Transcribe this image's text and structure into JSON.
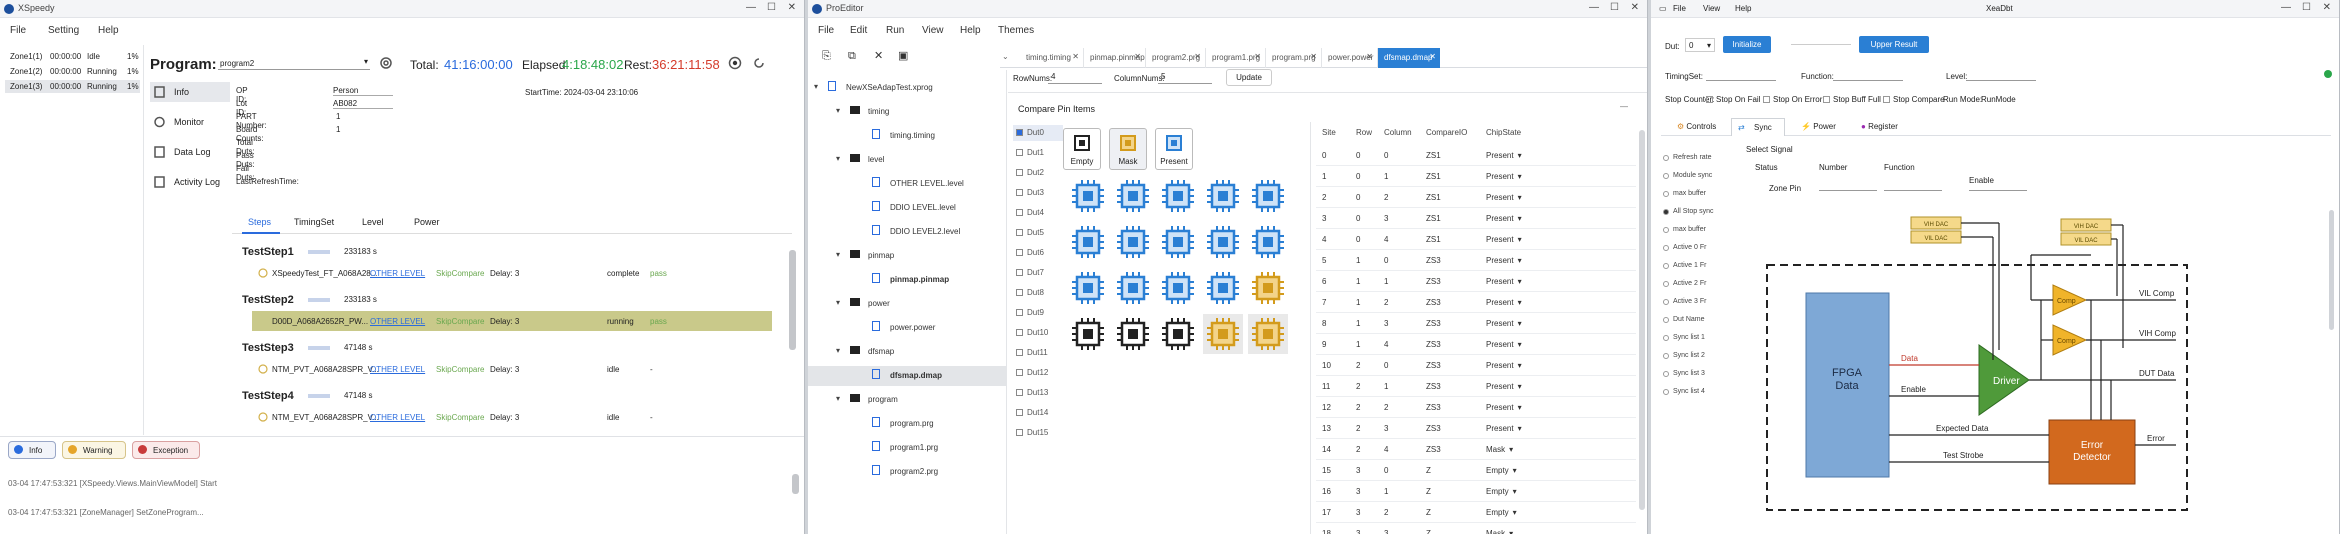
{
  "w1": {
    "title": "XSpeedy",
    "menu": [
      "File",
      "Setting",
      "Help"
    ],
    "zones": [
      {
        "name": "Zone1(1)",
        "time": "00:00:00",
        "state": "Idle",
        "pct": "1%"
      },
      {
        "name": "Zone1(2)",
        "time": "00:00:00",
        "state": "Running",
        "pct": "1%"
      },
      {
        "name": "Zone1(3)",
        "time": "00:00:00",
        "state": "Running",
        "pct": "1%"
      }
    ],
    "program_label": "Program:",
    "program_value": "program2",
    "total_label": "Total:",
    "total_value": "41:16:00:00",
    "elapsed_label": "Elapsed:",
    "elapsed_value": "4:18:48:02",
    "rest_label": "Rest:",
    "rest_value": "36:21:11:58",
    "nav": [
      "Info",
      "Monitor",
      "Data Log",
      "Activity Log"
    ],
    "info_labels": [
      "OP ID:",
      "Lot ID:",
      "PART Number:",
      "Board Counts:",
      "Total Duts:",
      "Pass Duts:",
      "Fail Duts:",
      "LastRefreshTime:"
    ],
    "info_values": [
      "Person",
      "AB082",
      "1",
      "1",
      "",
      "",
      "",
      ""
    ],
    "start_time": "StartTime: 2024-03-04 23:10:06",
    "subtabs": [
      "Steps",
      "TimingSet",
      "Level",
      "Power"
    ],
    "steps": [
      {
        "name": "TestStep1",
        "id": "233183 s",
        "detail": "XSpeedyTest_FT_A068A28...",
        "link": "OTHER LEVEL",
        "mode": "SkipCompare",
        "delay": "Delay: 3",
        "status": "complete",
        "result": "pass"
      },
      {
        "name": "TestStep2",
        "id": "233183 s",
        "detail": "D00D_A068A2652R_PW...",
        "link": "OTHER LEVEL",
        "mode": "SkipCompare",
        "delay": "Delay: 3",
        "status": "running",
        "result": "pass"
      },
      {
        "name": "TestStep3",
        "id": "47148 s",
        "detail": "NTM_PVT_A068A28SPR_V...",
        "link": "OTHER LEVEL",
        "mode": "SkipCompare",
        "delay": "Delay: 3",
        "status": "idle",
        "result": "-"
      },
      {
        "name": "TestStep4",
        "id": "47148 s",
        "detail": "NTM_EVT_A068A28SPR_V...",
        "link": "OTHER LEVEL",
        "mode": "SkipCompare",
        "delay": "Delay: 3",
        "status": "idle",
        "result": "-"
      }
    ],
    "log_buttons": [
      "Info",
      "Warning",
      "Exception"
    ],
    "logs": [
      "03-04 17:47:53:321 [XSpeedy.Views.MainViewModel] Start",
      "03-04 17:47:53:321 [ZoneManager] SetZoneProgram..."
    ]
  },
  "w2": {
    "title": "ProEditor",
    "menu": [
      "File",
      "Edit",
      "Run",
      "View",
      "Help",
      "Themes"
    ],
    "tabs": [
      "timing.timing",
      "pinmap.pinmap",
      "program2.prg",
      "program1.prg",
      "program.prg",
      "power.power",
      "dfsmap.dmap"
    ],
    "tree": [
      {
        "label": "NewXSeAdapTest.xprog",
        "indent": 0,
        "type": "file"
      },
      {
        "label": "timing",
        "indent": 1,
        "type": "folder"
      },
      {
        "label": "timing.timing",
        "indent": 2,
        "type": "file"
      },
      {
        "label": "level",
        "indent": 1,
        "type": "folder"
      },
      {
        "label": "OTHER LEVEL.level",
        "indent": 2,
        "type": "file"
      },
      {
        "label": "DDIO LEVEL.level",
        "indent": 2,
        "type": "file"
      },
      {
        "label": "DDIO LEVEL2.level",
        "indent": 2,
        "type": "file"
      },
      {
        "label": "pinmap",
        "indent": 1,
        "type": "folder"
      },
      {
        "label": "pinmap.pinmap",
        "indent": 2,
        "type": "file"
      },
      {
        "label": "power",
        "indent": 1,
        "type": "folder"
      },
      {
        "label": "power.power",
        "indent": 2,
        "type": "file"
      },
      {
        "label": "dfsmap",
        "indent": 1,
        "type": "folder"
      },
      {
        "label": "dfsmap.dmap",
        "indent": 2,
        "type": "file"
      },
      {
        "label": "program",
        "indent": 1,
        "type": "folder"
      },
      {
        "label": "program.prg",
        "indent": 2,
        "type": "file"
      },
      {
        "label": "program1.prg",
        "indent": 2,
        "type": "file"
      },
      {
        "label": "program2.prg",
        "indent": 2,
        "type": "file"
      }
    ],
    "rows_label": "RowNums:",
    "rows_val": "4",
    "cols_label": "ColumnNums:",
    "cols_val": "5",
    "update_btn": "Update",
    "section": "Compare Pin Items",
    "duts": [
      "Dut0",
      "Dut1",
      "Dut2",
      "Dut3",
      "Dut4",
      "Dut5",
      "Dut6",
      "Dut7",
      "Dut8",
      "Dut9",
      "Dut10",
      "Dut11",
      "Dut12",
      "Dut13",
      "Dut14",
      "Dut15"
    ],
    "chip_buttons": [
      "Empty",
      "Mask",
      "Present"
    ],
    "grid": [
      [
        "blue",
        "blue",
        "blue",
        "blue",
        "blue"
      ],
      [
        "blue",
        "blue",
        "blue",
        "blue",
        "blue"
      ],
      [
        "blue",
        "blue",
        "blue",
        "blue",
        "yellow"
      ],
      [
        "black",
        "black",
        "black",
        "yellow",
        "yellow"
      ]
    ],
    "table_headers": [
      "Site",
      "Row",
      "Column",
      "CompareIO",
      "ChipState"
    ],
    "table": [
      [
        "0",
        "0",
        "0",
        "ZS1",
        "Present"
      ],
      [
        "1",
        "0",
        "1",
        "ZS1",
        "Present"
      ],
      [
        "2",
        "0",
        "2",
        "ZS1",
        "Present"
      ],
      [
        "3",
        "0",
        "3",
        "ZS1",
        "Present"
      ],
      [
        "4",
        "0",
        "4",
        "ZS1",
        "Present"
      ],
      [
        "5",
        "1",
        "0",
        "ZS3",
        "Present"
      ],
      [
        "6",
        "1",
        "1",
        "ZS3",
        "Present"
      ],
      [
        "7",
        "1",
        "2",
        "ZS3",
        "Present"
      ],
      [
        "8",
        "1",
        "3",
        "ZS3",
        "Present"
      ],
      [
        "9",
        "1",
        "4",
        "ZS3",
        "Present"
      ],
      [
        "10",
        "2",
        "0",
        "ZS3",
        "Present"
      ],
      [
        "11",
        "2",
        "1",
        "ZS3",
        "Present"
      ],
      [
        "12",
        "2",
        "2",
        "ZS3",
        "Present"
      ],
      [
        "13",
        "2",
        "3",
        "ZS3",
        "Present"
      ],
      [
        "14",
        "2",
        "4",
        "ZS3",
        "Mask"
      ],
      [
        "15",
        "3",
        "0",
        "Z",
        "Empty"
      ],
      [
        "16",
        "3",
        "1",
        "Z",
        "Empty"
      ],
      [
        "17",
        "3",
        "2",
        "Z",
        "Empty"
      ],
      [
        "18",
        "3",
        "3",
        "Z",
        "Mask"
      ]
    ]
  },
  "w3": {
    "title": "XeaDbt",
    "menu": [
      "File",
      "View",
      "Help"
    ],
    "dut_label": "Dut:",
    "dut_val": "0",
    "btn_init": "Initialize",
    "btn_upper": "Upper Result",
    "row2": [
      "TimingSet:",
      "Function:",
      "Level:"
    ],
    "row3": [
      "Stop Counter:",
      "Stop On Fail",
      "Stop On Error",
      "Stop Buff Full",
      "Stop Compare",
      "Run Mode:",
      "RunMode"
    ],
    "tabs": [
      "Controls",
      "Sync",
      "Power",
      "Register"
    ],
    "side_items": [
      "Refresh rate",
      "Module sync",
      "max buffer",
      "All Stop sync",
      "max buffer",
      "Active 0 Fr",
      "Active 1 Fr",
      "Active 2 Fr",
      "Active 3 Fr",
      "Dut Name",
      "Sync list 1",
      "Sync list 2",
      "Sync list 3",
      "Sync list 4"
    ],
    "form_labels": [
      "Status",
      "Number",
      "Function",
      "Enable",
      "Zone Pin"
    ],
    "select_signal": "Select Signal",
    "diagram": {
      "fpga": "FPGA\nData",
      "driver": "Driver",
      "comp": "Comp",
      "err": "Error\nDetector",
      "data": "Data",
      "enable": "Enable",
      "expected": "Expected Data",
      "strobe": "Test Strobe",
      "error": "Error",
      "vol": [
        "VIH DAC",
        "VIL DAC"
      ],
      "vor": [
        "VIH DAC",
        "VIL DAC"
      ],
      "outs": [
        "VIL Comp",
        "VIH Comp",
        "DUT Data"
      ]
    }
  }
}
